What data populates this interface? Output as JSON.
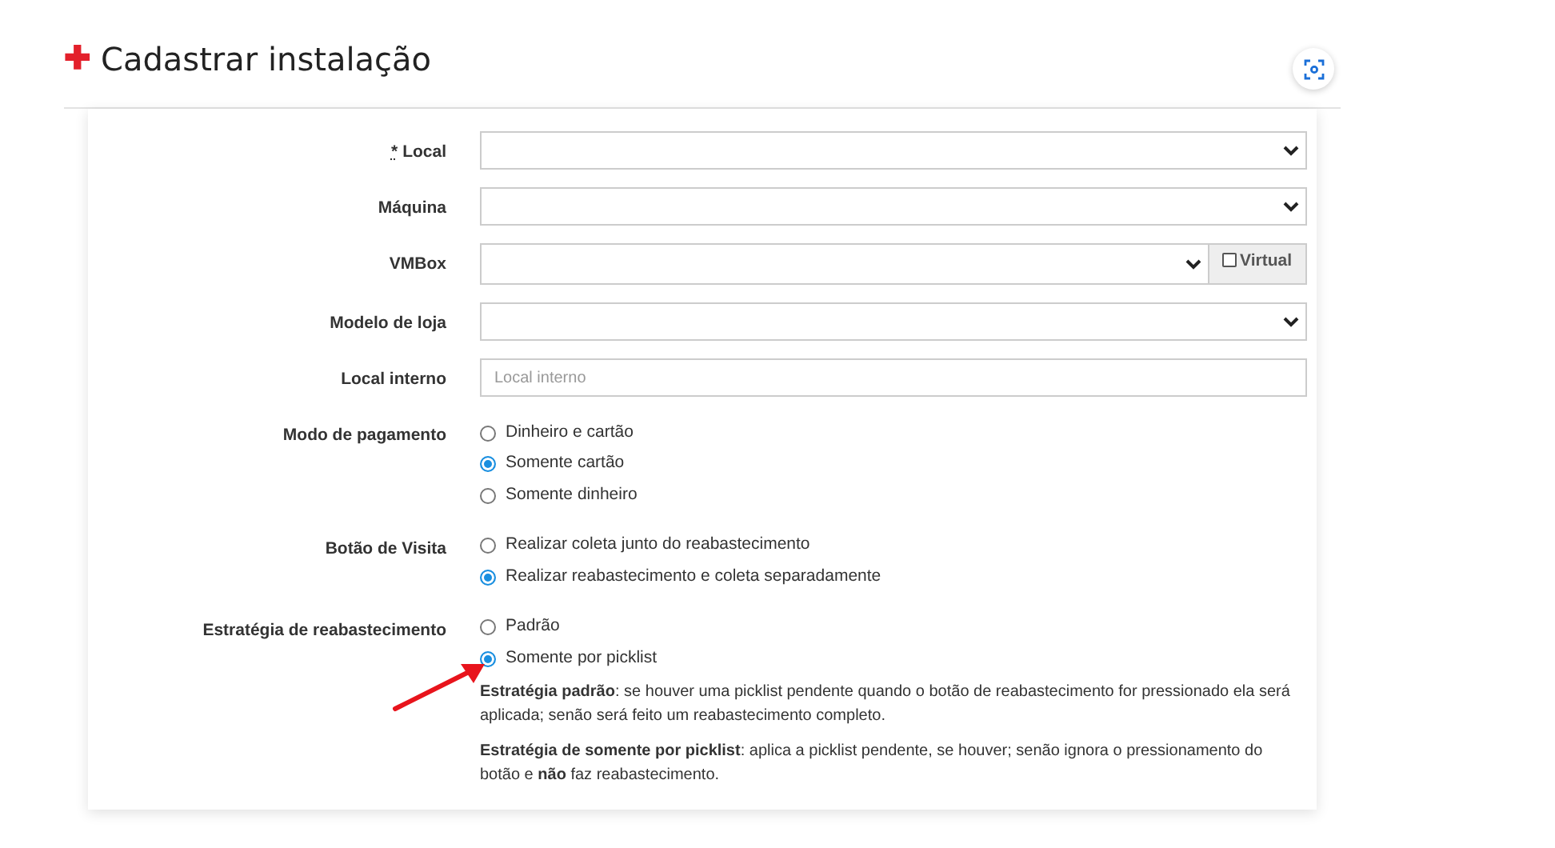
{
  "header": {
    "icon": "✚",
    "title": "Cadastrar instalação"
  },
  "fields": [
    {
      "kind": "select",
      "label": "Local",
      "required_mark": "*"
    },
    {
      "kind": "select",
      "label": "Máquina"
    },
    {
      "kind": "select_check",
      "label": "VMBox",
      "check": {
        "label": "Virtual",
        "checked": false
      }
    },
    {
      "kind": "select",
      "label": "Modelo de loja"
    },
    {
      "kind": "text",
      "label": "Local interno",
      "placeholder": "Local interno"
    },
    {
      "kind": "radio",
      "label": "Modo de pagamento",
      "options": [
        {
          "label": "Dinheiro e cartão",
          "selected": false
        },
        {
          "label": "Somente cartão",
          "selected": true
        },
        {
          "label": "Somente dinheiro",
          "selected": false
        }
      ]
    },
    {
      "kind": "radio",
      "label": "Botão de Visita",
      "options": [
        {
          "label": "Realizar coleta junto do reabastecimento",
          "selected": false
        },
        {
          "label": "Realizar reabastecimento e coleta separadamente",
          "selected": true
        }
      ]
    },
    {
      "kind": "radio",
      "label": "Estratégia de reabastecimento",
      "options": [
        {
          "label": "Padrão",
          "selected": false
        },
        {
          "label": "Somente por picklist",
          "selected": true
        }
      ],
      "help": [
        "**Estratégia padrão**: se houver uma picklist pendente quando o botão de reabastecimento for pressionado ela será aplicada; senão será feito um reabastecimento completo.",
        "**Estratégia de somente por picklist**: aplica a picklist pendente, se houver; senão ignora o pressionamento do botão e **não** faz reabastecimento."
      ]
    }
  ]
}
